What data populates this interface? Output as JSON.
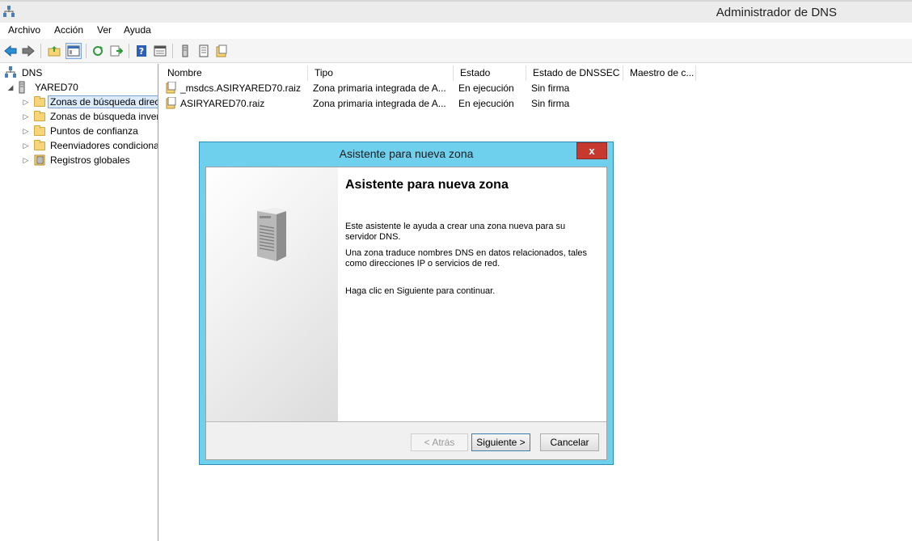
{
  "window": {
    "title": "Administrador de DNS"
  },
  "menu": [
    "Archivo",
    "Acción",
    "Ver",
    "Ayuda"
  ],
  "toolbar": {
    "buttons": [
      "back-icon",
      "forward-icon",
      "up-folder-icon",
      "show-hide-tree-icon",
      "refresh-icon",
      "export-list-icon",
      "help-icon",
      "properties-icon",
      "server-icon",
      "list-icon",
      "zone-icon"
    ]
  },
  "tree": {
    "root": "DNS",
    "server": "YARED70",
    "items": [
      {
        "label": "Zonas de búsqueda directa",
        "icon": "folder-icon",
        "selected": true
      },
      {
        "label": "Zonas de búsqueda inversa",
        "icon": "folder-icon",
        "selected": false
      },
      {
        "label": "Puntos de confianza",
        "icon": "folder-icon",
        "selected": false
      },
      {
        "label": "Reenviadores condicionales",
        "icon": "folder-icon",
        "selected": false
      },
      {
        "label": "Registros globales",
        "icon": "global-records-icon",
        "selected": false
      }
    ]
  },
  "list": {
    "columns": [
      "Nombre",
      "Tipo",
      "Estado",
      "Estado de DNSSEC",
      "Maestro de c..."
    ],
    "rows": [
      {
        "name": "_msdcs.ASIRYARED70.raiz",
        "type": "Zona primaria integrada de A...",
        "status": "En ejecución",
        "dnssec": "Sin firma",
        "master": ""
      },
      {
        "name": "ASIRYARED70.raiz",
        "type": "Zona primaria integrada de A...",
        "status": "En ejecución",
        "dnssec": "Sin firma",
        "master": ""
      }
    ]
  },
  "dialog": {
    "title": "Asistente para nueva zona",
    "close": "x",
    "heading": "Asistente para nueva zona",
    "paragraphs": [
      "Este asistente le ayuda a crear una zona nueva para su servidor DNS.",
      "Una zona traduce nombres DNS en datos relacionados, tales como direcciones IP o servicios de red.",
      "Haga clic en Siguiente para continuar."
    ],
    "buttons": {
      "back": "< Atrás",
      "next": "Siguiente >",
      "cancel": "Cancelar"
    }
  }
}
